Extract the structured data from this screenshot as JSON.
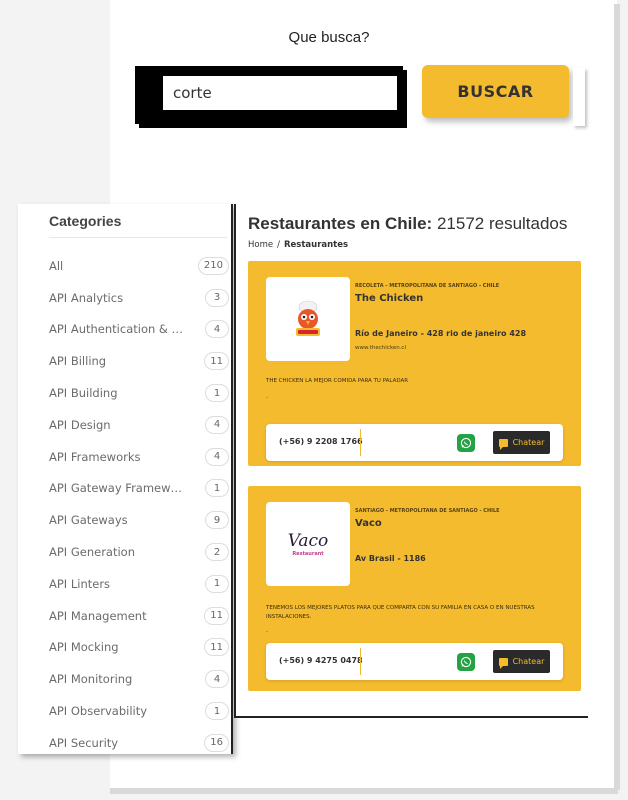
{
  "search": {
    "title": "Que busca?",
    "value": "corte",
    "button_label": "BUSCAR"
  },
  "sidebar": {
    "title": "Categories",
    "items": [
      {
        "label": "All",
        "count": "210"
      },
      {
        "label": "API Analytics",
        "count": "3"
      },
      {
        "label": "API Authentication & O...",
        "count": "4"
      },
      {
        "label": "API Billing",
        "count": "11"
      },
      {
        "label": "API Building",
        "count": "1"
      },
      {
        "label": "API Design",
        "count": "4"
      },
      {
        "label": "API Frameworks",
        "count": "4"
      },
      {
        "label": "API Gateway Framewor...",
        "count": "1"
      },
      {
        "label": "API Gateways",
        "count": "9"
      },
      {
        "label": "API Generation",
        "count": "2"
      },
      {
        "label": "API Linters",
        "count": "1"
      },
      {
        "label": "API Management",
        "count": "11"
      },
      {
        "label": "API Mocking",
        "count": "11"
      },
      {
        "label": "API Monitoring",
        "count": "4"
      },
      {
        "label": "API Observability",
        "count": "1"
      },
      {
        "label": "API Security",
        "count": "16"
      }
    ]
  },
  "results": {
    "title_bold": "Restaurantes en Chile:",
    "title_rest": " 21572 resultados",
    "breadcrumb": {
      "home": "Home",
      "separator": "/",
      "current": "Restaurantes"
    },
    "cards": [
      {
        "location": "RECOLETA - METROPOLITANA DE SANTIAGO - CHILE",
        "name": "The Chicken",
        "address": "Río de Janeiro - 428 rio de janeiro 428",
        "website": "www.thechicken.cl",
        "description": "THE CHICKEN LA MEJOR COMIDA PARA TU PALADAR",
        "dot": ".",
        "phone": "(+56) 9 2208 1766",
        "chat_label": "Chatear"
      },
      {
        "location": "SANTIAGO - METROPOLITANA DE SANTIAGO - CHILE",
        "name": "Vaco",
        "address": "Av Brasil - 1186",
        "website": "",
        "description": "TENEMOS LOS MEJORES PLATOS PARA QUE COMPARTA CON SU FAMILIA EN CASA O EN NUESTRAS INSTALACIONES.",
        "dot": ".",
        "phone": "(+56) 9 4275 0478",
        "chat_label": "Chatear",
        "logo_text": "Vaco",
        "logo_subtext": "Restaurant"
      }
    ]
  },
  "colors": {
    "accent": "#f5bb2e",
    "whatsapp": "#25a244",
    "dark": "#2a2a2a"
  },
  "icons": {
    "whatsapp": "whatsapp-icon",
    "chat": "chat-icon",
    "logo_chicken": "chicken-logo"
  }
}
